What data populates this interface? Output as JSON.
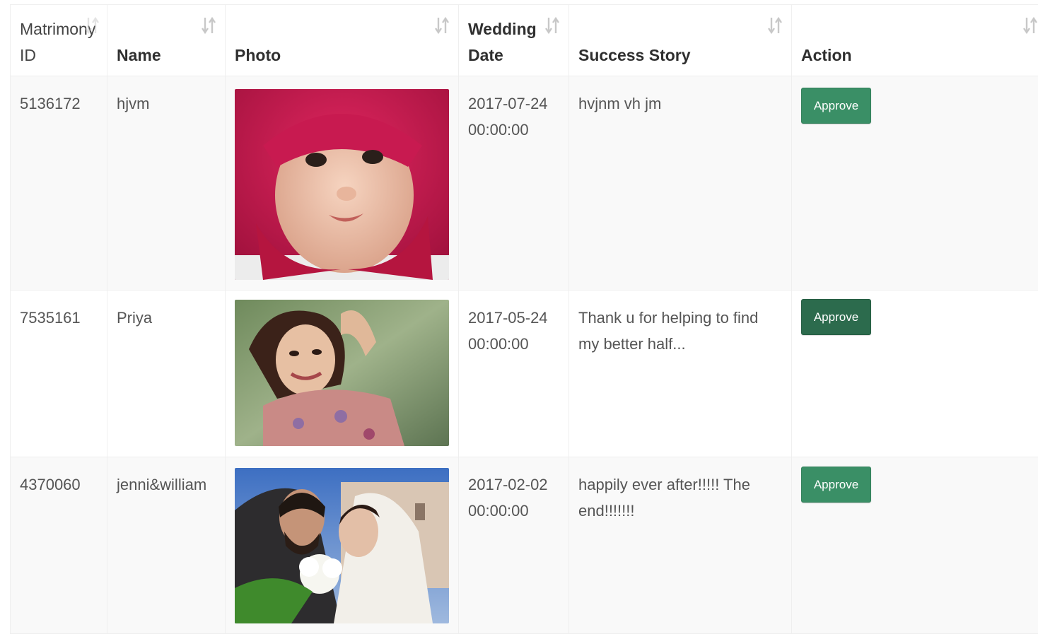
{
  "table": {
    "headers": [
      {
        "line1": "Matrimony",
        "line2": "ID"
      },
      {
        "label": "Name"
      },
      {
        "label": "Photo"
      },
      {
        "line1": "Wedding",
        "line2": "Date"
      },
      {
        "label": "Success Story"
      },
      {
        "label": "Action"
      }
    ],
    "rows": [
      {
        "id": "5136172",
        "name": "hjvm",
        "date": "2017-07-24",
        "time": "00:00:00",
        "story": "hvjnm vh jm",
        "action": "Approve"
      },
      {
        "id": "7535161",
        "name": "Priya",
        "date": "2017-05-24",
        "time": "00:00:00",
        "story": "Thank u for helping to find my better half...",
        "action": "Approve"
      },
      {
        "id": "4370060",
        "name": "jenni&william",
        "date": "2017-02-02",
        "time": "00:00:00",
        "story": "happily ever after!!!!! The end!!!!!!!",
        "action": "Approve"
      }
    ]
  },
  "colors": {
    "approve": "#3a8f66",
    "stripe": "#f9f9f9"
  }
}
